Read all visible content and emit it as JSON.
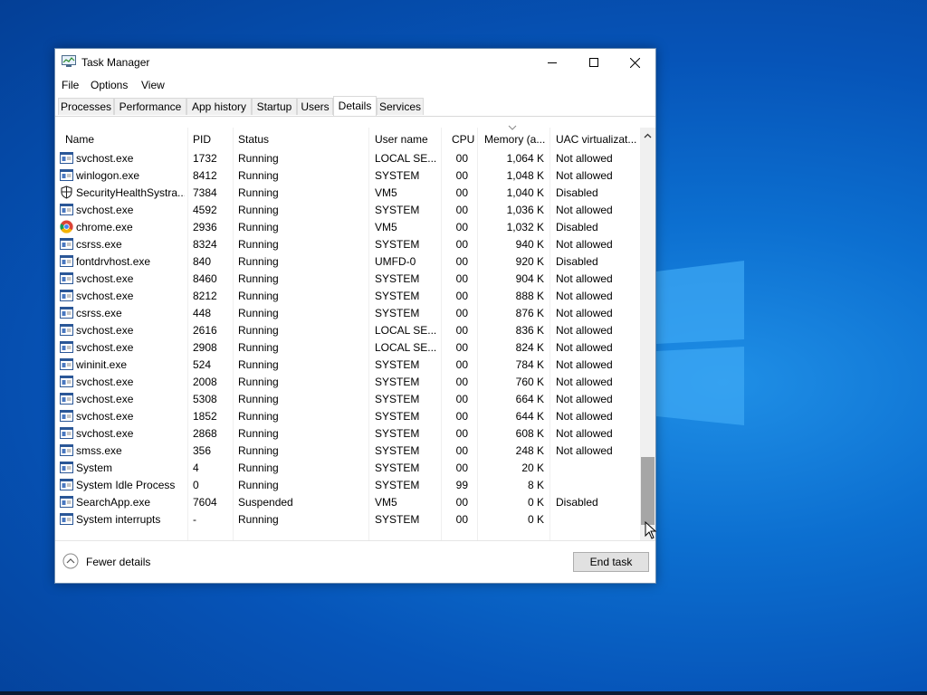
{
  "window": {
    "title": "Task Manager",
    "controls": {
      "minimize": "minimize",
      "maximize": "maximize",
      "close": "close"
    }
  },
  "menu": [
    "File",
    "Options",
    "View"
  ],
  "tabs": [
    {
      "label": "Processes",
      "active": false
    },
    {
      "label": "Performance",
      "active": false
    },
    {
      "label": "App history",
      "active": false
    },
    {
      "label": "Startup",
      "active": false
    },
    {
      "label": "Users",
      "active": false
    },
    {
      "label": "Details",
      "active": true
    },
    {
      "label": "Services",
      "active": false
    }
  ],
  "columns": [
    "Name",
    "PID",
    "Status",
    "User name",
    "CPU",
    "Memory (a...",
    "UAC virtualizat..."
  ],
  "rows": [
    {
      "icon": "service-icon",
      "name": "svchost.exe",
      "pid": "1732",
      "status": "Running",
      "user": "LOCAL SE...",
      "cpu": "00",
      "mem": "1,064 K",
      "uac": "Not allowed"
    },
    {
      "icon": "service-icon",
      "name": "winlogon.exe",
      "pid": "8412",
      "status": "Running",
      "user": "SYSTEM",
      "cpu": "00",
      "mem": "1,048 K",
      "uac": "Not allowed"
    },
    {
      "icon": "shield-icon",
      "name": "SecurityHealthSystra...",
      "pid": "7384",
      "status": "Running",
      "user": "VM5",
      "cpu": "00",
      "mem": "1,040 K",
      "uac": "Disabled"
    },
    {
      "icon": "service-icon",
      "name": "svchost.exe",
      "pid": "4592",
      "status": "Running",
      "user": "SYSTEM",
      "cpu": "00",
      "mem": "1,036 K",
      "uac": "Not allowed"
    },
    {
      "icon": "chrome-icon",
      "name": "chrome.exe",
      "pid": "2936",
      "status": "Running",
      "user": "VM5",
      "cpu": "00",
      "mem": "1,032 K",
      "uac": "Disabled"
    },
    {
      "icon": "service-icon",
      "name": "csrss.exe",
      "pid": "8324",
      "status": "Running",
      "user": "SYSTEM",
      "cpu": "00",
      "mem": "940 K",
      "uac": "Not allowed"
    },
    {
      "icon": "service-icon",
      "name": "fontdrvhost.exe",
      "pid": "840",
      "status": "Running",
      "user": "UMFD-0",
      "cpu": "00",
      "mem": "920 K",
      "uac": "Disabled"
    },
    {
      "icon": "service-icon",
      "name": "svchost.exe",
      "pid": "8460",
      "status": "Running",
      "user": "SYSTEM",
      "cpu": "00",
      "mem": "904 K",
      "uac": "Not allowed"
    },
    {
      "icon": "service-icon",
      "name": "svchost.exe",
      "pid": "8212",
      "status": "Running",
      "user": "SYSTEM",
      "cpu": "00",
      "mem": "888 K",
      "uac": "Not allowed"
    },
    {
      "icon": "service-icon",
      "name": "csrss.exe",
      "pid": "448",
      "status": "Running",
      "user": "SYSTEM",
      "cpu": "00",
      "mem": "876 K",
      "uac": "Not allowed"
    },
    {
      "icon": "service-icon",
      "name": "svchost.exe",
      "pid": "2616",
      "status": "Running",
      "user": "LOCAL SE...",
      "cpu": "00",
      "mem": "836 K",
      "uac": "Not allowed"
    },
    {
      "icon": "service-icon",
      "name": "svchost.exe",
      "pid": "2908",
      "status": "Running",
      "user": "LOCAL SE...",
      "cpu": "00",
      "mem": "824 K",
      "uac": "Not allowed"
    },
    {
      "icon": "service-icon",
      "name": "wininit.exe",
      "pid": "524",
      "status": "Running",
      "user": "SYSTEM",
      "cpu": "00",
      "mem": "784 K",
      "uac": "Not allowed"
    },
    {
      "icon": "service-icon",
      "name": "svchost.exe",
      "pid": "2008",
      "status": "Running",
      "user": "SYSTEM",
      "cpu": "00",
      "mem": "760 K",
      "uac": "Not allowed"
    },
    {
      "icon": "service-icon",
      "name": "svchost.exe",
      "pid": "5308",
      "status": "Running",
      "user": "SYSTEM",
      "cpu": "00",
      "mem": "664 K",
      "uac": "Not allowed"
    },
    {
      "icon": "service-icon",
      "name": "svchost.exe",
      "pid": "1852",
      "status": "Running",
      "user": "SYSTEM",
      "cpu": "00",
      "mem": "644 K",
      "uac": "Not allowed"
    },
    {
      "icon": "service-icon",
      "name": "svchost.exe",
      "pid": "2868",
      "status": "Running",
      "user": "SYSTEM",
      "cpu": "00",
      "mem": "608 K",
      "uac": "Not allowed"
    },
    {
      "icon": "service-icon",
      "name": "smss.exe",
      "pid": "356",
      "status": "Running",
      "user": "SYSTEM",
      "cpu": "00",
      "mem": "248 K",
      "uac": "Not allowed"
    },
    {
      "icon": "service-icon",
      "name": "System",
      "pid": "4",
      "status": "Running",
      "user": "SYSTEM",
      "cpu": "00",
      "mem": "20 K",
      "uac": ""
    },
    {
      "icon": "service-icon",
      "name": "System Idle Process",
      "pid": "0",
      "status": "Running",
      "user": "SYSTEM",
      "cpu": "99",
      "mem": "8 K",
      "uac": ""
    },
    {
      "icon": "service-icon",
      "name": "SearchApp.exe",
      "pid": "7604",
      "status": "Suspended",
      "user": "VM5",
      "cpu": "00",
      "mem": "0 K",
      "uac": "Disabled"
    },
    {
      "icon": "service-icon",
      "name": "System interrupts",
      "pid": "-",
      "status": "Running",
      "user": "SYSTEM",
      "cpu": "00",
      "mem": "0 K",
      "uac": ""
    }
  ],
  "footer": {
    "fewer_details": "Fewer details",
    "end_task": "End task"
  },
  "colors": {
    "desktop": "#0a6ad0",
    "thumb": "#a6a6a6",
    "button": "#e1e1e1"
  }
}
